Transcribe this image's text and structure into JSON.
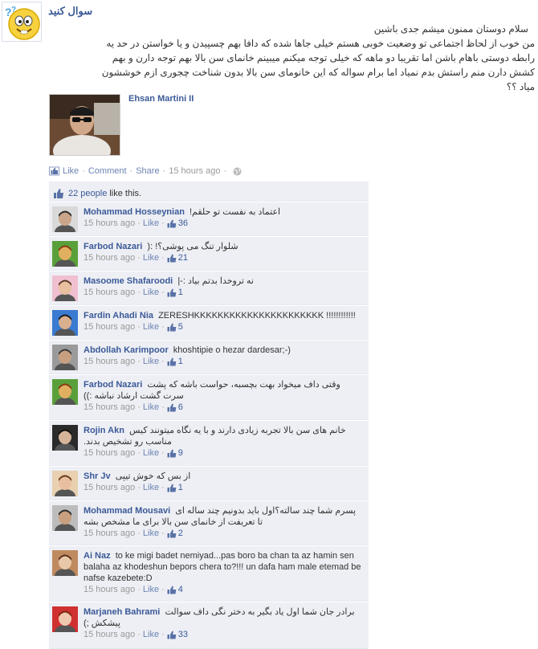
{
  "post": {
    "page_name": "سوال کنید",
    "lines": [
      "سلام دوستان ممنون میشم جدی باشین",
      "من خوب از لحاظ اجتماعی تو وضعیت خوبی هستم خیلی جاها شده که دافا بهم چسپیدن و یا خواستن در حد یه",
      "رابطه دوستی باهام باشن اما تقریبا دو ماهه که خیلی توجه میکنم میبینم خانمای سن بالا بهم توجه دارن و بهم",
      "کشش دارن منم راستش بدم نمیاد اما برام سواله که این خانومای سن بالا بدون شناخت چجوری ازم خوششون",
      "میاد ؟؟"
    ]
  },
  "attachment": {
    "name": "Ehsan Martini II"
  },
  "actions": {
    "like": "Like",
    "comment": "Comment",
    "share": "Share",
    "dot": "·",
    "time": "15 hours ago"
  },
  "likes": {
    "people": "22 people",
    "suffix": "like this."
  },
  "comments": [
    {
      "name": "Mohammad Hosseynian",
      "text": "اعتماد به نفست تو حلقم!",
      "rtl": true,
      "time": "15 hours ago",
      "like": "Like",
      "count": "36"
    },
    {
      "name": "Farbod Nazari",
      "text": "شلوار تنگ می پوشی؟! :(",
      "rtl": true,
      "time": "15 hours ago",
      "like": "Like",
      "count": "21"
    },
    {
      "name": "Masoome Shafaroodi",
      "text": "نه تروخدا بدتم بیاد :-|",
      "rtl": true,
      "time": "15 hours ago",
      "like": "Like",
      "count": "1"
    },
    {
      "name": "Fardin Ahadi Nia",
      "text": "ZERESHKKKKKKKKKKKKKKKKKKKKKK !!!!!!!!!!!!",
      "rtl": false,
      "time": "15 hours ago",
      "like": "Like",
      "count": "5"
    },
    {
      "name": "Abdollah Karimpoor",
      "text": "khoshtipie o hezar dardesar;-)",
      "rtl": false,
      "time": "15 hours ago",
      "like": "Like",
      "count": "1"
    },
    {
      "name": "Farbod Nazari",
      "text": "وقتی داف میخواد بهت بچسبه، حواست باشه که پشت سرت گشت ارشاد نباشه :))",
      "rtl": true,
      "time": "15 hours ago",
      "like": "Like",
      "count": "6"
    },
    {
      "name": "Rojin Akn",
      "text": "خانم های سن بالا تجربه زیادی دارند و با یه نگاه میتونند کیس مناسب رو تشخیص بدند.",
      "rtl": true,
      "time": "15 hours ago",
      "like": "Like",
      "count": "9"
    },
    {
      "name": "Shr Jv",
      "text": "از بس که خوش تیپی",
      "rtl": true,
      "time": "15 hours ago",
      "like": "Like",
      "count": "1"
    },
    {
      "name": "Mohammad Mousavi",
      "text": "پسرم شما چند سالته؟اول باید بدونیم چند ساله ای تا تعریفت از خانمای سن بالا برای ما مشخص بشه",
      "rtl": true,
      "time": "15 hours ago",
      "like": "Like",
      "count": "2"
    },
    {
      "name": "Ai Naz",
      "text": "to ke migi badet nemiyad...pas boro ba chan ta az hamin sen balaha az khodeshun bepors chera to?!!! un dafa ham male etemad be nafse kazebete:D",
      "rtl": false,
      "time": "15 hours ago",
      "like": "Like",
      "count": "4"
    },
    {
      "name": "Marjaneh Bahrami",
      "text": "برادر جان شما اول یاد بگیر به دختر نگی داف سوالت پیشکش ;)",
      "rtl": true,
      "time": "15 hours ago",
      "like": "Like",
      "count": "33"
    }
  ],
  "colors": {
    "link": "#3b5998",
    "muted": "#999999",
    "box_bg": "#edeff4"
  }
}
